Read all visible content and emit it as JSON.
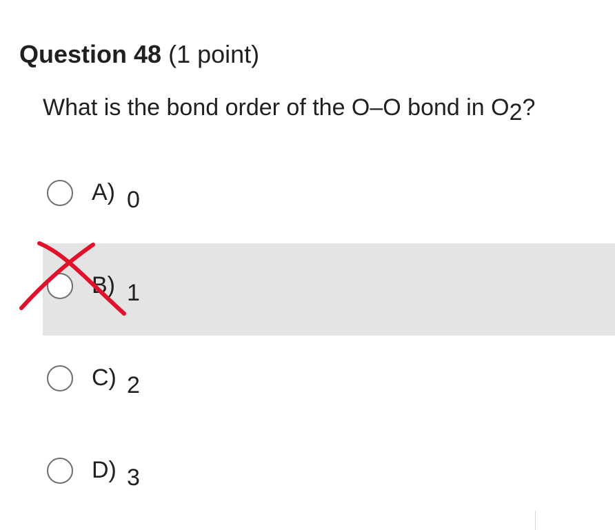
{
  "question": {
    "title": "Question 48",
    "points": "(1 point)",
    "text_before": "What is the bond order of the O–O bond in O",
    "subscript": "2",
    "text_after": "?"
  },
  "options": [
    {
      "label": "A)",
      "value": "0"
    },
    {
      "label": "B)",
      "value": "1"
    },
    {
      "label": "C)",
      "value": "2"
    },
    {
      "label": "D)",
      "value": "3"
    }
  ],
  "colors": {
    "highlight_row": "#e4e4e4",
    "annotation_cross": "#e0112a",
    "radio_border": "#6d6d6d"
  },
  "annotation": {
    "icon": "red-x-mark-icon",
    "marked_option": "B)"
  }
}
